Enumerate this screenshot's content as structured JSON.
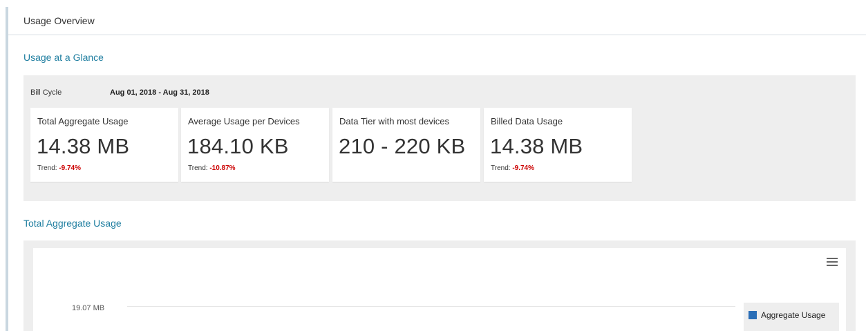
{
  "panel": {
    "title": "Usage Overview"
  },
  "glance": {
    "title": "Usage at a Glance",
    "bill_cycle_label": "Bill Cycle",
    "bill_cycle_value": "Aug 01, 2018 - Aug 31, 2018",
    "cards": [
      {
        "label": "Total Aggregate Usage",
        "value": "14.38 MB",
        "trend_label": "Trend: ",
        "trend_value": "-9.74%"
      },
      {
        "label": "Average Usage per Devices",
        "value": "184.10 KB",
        "trend_label": "Trend: ",
        "trend_value": "-10.87%"
      },
      {
        "label": "Data Tier with most devices",
        "value": "210 - 220 KB",
        "trend_label": "",
        "trend_value": ""
      },
      {
        "label": "Billed Data Usage",
        "value": "14.38 MB",
        "trend_label": "Trend: ",
        "trend_value": "-9.74%"
      }
    ]
  },
  "chart_section": {
    "title": "Total Aggregate Usage",
    "menu_icon": "hamburger-menu-icon",
    "colors": {
      "series": "#2a6eb7",
      "trend_negative": "#cc0000",
      "section_title": "#1f7ea0"
    }
  },
  "chart_data": {
    "type": "bar",
    "y_tick_labels": [
      "19.07 MB"
    ],
    "series": [
      {
        "name": "Aggregate Usage",
        "values": []
      }
    ],
    "legend_position": "right"
  }
}
